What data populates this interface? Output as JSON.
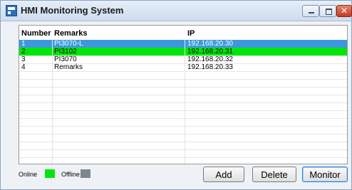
{
  "window": {
    "title": "HMI Monitoring System",
    "app_icon": "hmi-app-icon",
    "controls": {
      "minimize_icon": "minimize-icon",
      "maximize_icon": "maximize-icon",
      "close_icon": "close-icon",
      "close_glyph": "✕"
    }
  },
  "table": {
    "columns": {
      "number": "Number",
      "remarks": "Remarks",
      "ip": "IP"
    },
    "rows": [
      {
        "number": "1",
        "remarks": "PI3070-L",
        "ip": "192.168.20.30",
        "state": "selected"
      },
      {
        "number": "2",
        "remarks": "PI3102",
        "ip": "192.168.20.31",
        "state": "online"
      },
      {
        "number": "3",
        "remarks": "PI3070",
        "ip": "192.168.20.32",
        "state": "offline"
      },
      {
        "number": "4",
        "remarks": "Remarks",
        "ip": "192.168.20.33",
        "state": "offline"
      }
    ],
    "empty_row_count": 13
  },
  "legend": {
    "online_label": "Online",
    "online_color": "#00e60a",
    "offline_label": "Offline",
    "offline_color": "#7d8791"
  },
  "buttons": {
    "add": "Add",
    "delete": "Delete",
    "monitor": "Monitor"
  },
  "colors": {
    "selection": "#3d97e0",
    "online_row": "#00e60a"
  }
}
